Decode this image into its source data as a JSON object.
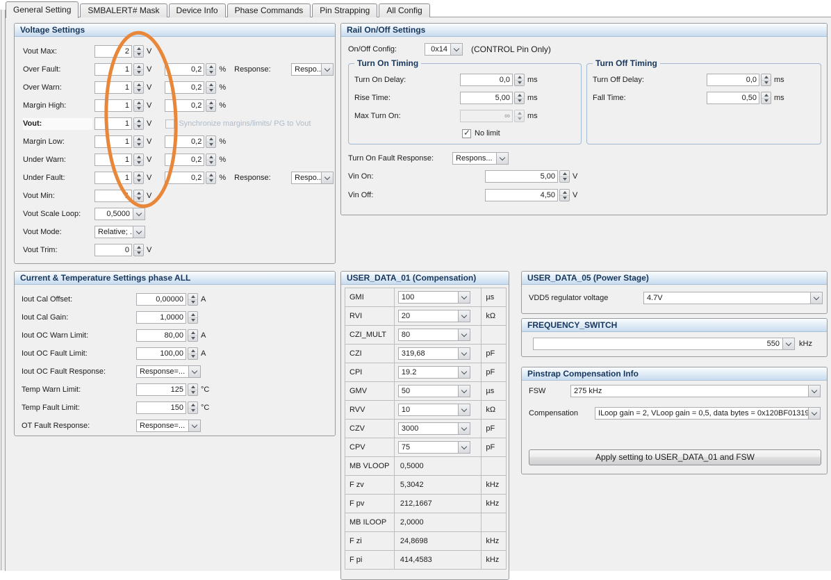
{
  "tabs": [
    {
      "label": "General Setting",
      "active": true
    },
    {
      "label": "SMBALERT# Mask",
      "active": false
    },
    {
      "label": "Device Info",
      "active": false
    },
    {
      "label": "Phase Commands",
      "active": false
    },
    {
      "label": "Pin Strapping",
      "active": false
    },
    {
      "label": "All Config",
      "active": false
    }
  ],
  "voltage": {
    "title": "Voltage Settings",
    "vout_max": {
      "label": "Vout Max:",
      "value": "2",
      "unit": "V"
    },
    "over_fault": {
      "label": "Over Fault:",
      "value": "1",
      "unit": "V",
      "pct": "0,2",
      "pct_unit": "%",
      "response_label": "Response:",
      "response": "Respo..."
    },
    "over_warn": {
      "label": "Over Warn:",
      "value": "1",
      "unit": "V",
      "pct": "0,2",
      "pct_unit": "%"
    },
    "margin_high": {
      "label": "Margin High:",
      "value": "1",
      "unit": "V",
      "pct": "0,2",
      "pct_unit": "%"
    },
    "vout": {
      "label": "Vout:",
      "value": "1",
      "unit": "V",
      "sync_label": "Synchronize margins/limits/ PG to Vout"
    },
    "margin_low": {
      "label": "Margin Low:",
      "value": "1",
      "unit": "V",
      "pct": "0,2",
      "pct_unit": "%"
    },
    "under_warn": {
      "label": "Under Warn:",
      "value": "1",
      "unit": "V",
      "pct": "0,2",
      "pct_unit": "%"
    },
    "under_fault": {
      "label": "Under Fault:",
      "value": "1",
      "unit": "V",
      "pct": "0,2",
      "pct_unit": "%",
      "response_label": "Response:",
      "response": "Respo..."
    },
    "vout_min": {
      "label": "Vout Min:",
      "value": "1",
      "unit": "V"
    },
    "vout_scale_loop": {
      "label": "Vout Scale Loop:",
      "value": "0,5000"
    },
    "vout_mode": {
      "label": "Vout Mode:",
      "value": "Relative; ..."
    },
    "vout_trim": {
      "label": "Vout Trim:",
      "value": "0",
      "unit": "V"
    }
  },
  "rail": {
    "title": "Rail On/Off Settings",
    "onoff_config": {
      "label": "On/Off Config:",
      "value": "0x14",
      "note": "(CONTROL Pin Only)"
    },
    "turn_on": {
      "title": "Turn On Timing",
      "delay": {
        "label": "Turn On Delay:",
        "value": "0,0",
        "unit": "ms"
      },
      "rise": {
        "label": "Rise Time:",
        "value": "5,00",
        "unit": "ms"
      },
      "max_on": {
        "label": "Max Turn On:",
        "value": "∞",
        "unit": "ms"
      },
      "no_limit_label": "No limit",
      "no_limit_checked": true
    },
    "turn_off": {
      "title": "Turn Off Timing",
      "delay": {
        "label": "Turn Off Delay:",
        "value": "0,0",
        "unit": "ms"
      },
      "fall": {
        "label": "Fall Time:",
        "value": "0,50",
        "unit": "ms"
      }
    },
    "fault_response": {
      "label": "Turn On Fault Response:",
      "value": "Respons..."
    },
    "vin_on": {
      "label": "Vin On:",
      "value": "5,00",
      "unit": "V"
    },
    "vin_off": {
      "label": "Vin Off:",
      "value": "4,50",
      "unit": "V"
    }
  },
  "current_temp": {
    "title": "Current & Temperature Settings phase ALL",
    "iout_cal_offset": {
      "label": "Iout Cal Offset:",
      "value": "0,00000",
      "unit": "A"
    },
    "iout_cal_gain": {
      "label": "Iout Cal Gain:",
      "value": "1,0000",
      "unit": ""
    },
    "iout_oc_warn": {
      "label": "Iout OC Warn Limit:",
      "value": "80,00",
      "unit": "A"
    },
    "iout_oc_fault": {
      "label": "Iout OC Fault Limit:",
      "value": "100,00",
      "unit": "A"
    },
    "iout_oc_fault_response": {
      "label": "Iout OC Fault Response:",
      "value": "Response=..."
    },
    "temp_warn": {
      "label": "Temp Warn Limit:",
      "value": "125",
      "unit": "°C"
    },
    "temp_fault": {
      "label": "Temp Fault Limit:",
      "value": "150",
      "unit": "°C"
    },
    "ot_fault_response": {
      "label": "OT Fault Response:",
      "value": "Response=..."
    }
  },
  "user_data_01": {
    "title": "USER_DATA_01 (Compensation)",
    "rows": [
      {
        "label": "GMI",
        "value": "100",
        "unit": "µs",
        "editable": true
      },
      {
        "label": "RVI",
        "value": "20",
        "unit": "kΩ",
        "editable": true
      },
      {
        "label": "CZI_MULT",
        "value": "80",
        "unit": "",
        "editable": true
      },
      {
        "label": "CZI",
        "value": "319,68",
        "unit": "pF",
        "editable": true
      },
      {
        "label": "CPI",
        "value": "19.2",
        "unit": "pF",
        "editable": true
      },
      {
        "label": "GMV",
        "value": "50",
        "unit": "µs",
        "editable": true
      },
      {
        "label": "RVV",
        "value": "10",
        "unit": "kΩ",
        "editable": true
      },
      {
        "label": "CZV",
        "value": "3000",
        "unit": "pF",
        "editable": true
      },
      {
        "label": "CPV",
        "value": "75",
        "unit": "pF",
        "editable": true
      },
      {
        "label": "MB VLOOP",
        "value": "0,5000",
        "unit": "",
        "editable": false
      },
      {
        "label": "F zv",
        "value": "5,3042",
        "unit": "kHz",
        "editable": false
      },
      {
        "label": "F pv",
        "value": "212,1667",
        "unit": "kHz",
        "editable": false
      },
      {
        "label": "MB ILOOP",
        "value": "2,0000",
        "unit": "",
        "editable": false
      },
      {
        "label": "F zi",
        "value": "24,8698",
        "unit": "kHz",
        "editable": false
      },
      {
        "label": "F pi",
        "value": "414,4583",
        "unit": "kHz",
        "editable": false
      }
    ]
  },
  "user_data_05": {
    "title": "USER_DATA_05 (Power Stage)",
    "vdd5": {
      "label": "VDD5 regulator voltage",
      "value": "4.7V"
    }
  },
  "frequency_switch": {
    "title": "FREQUENCY_SWITCH",
    "value": "550",
    "unit": "kHz"
  },
  "pinstrap": {
    "title": "Pinstrap Compensation Info",
    "fsw": {
      "label": "FSW",
      "value": "275 kHz"
    },
    "compensation": {
      "label": "Compensation",
      "value": "ILoop gain = 2, VLoop gain = 0,5, data bytes = 0x120BF01319"
    },
    "apply_button": "Apply setting to USER_DATA_01 and FSW"
  },
  "annotation": {
    "type": "ellipse",
    "color": "#E8873A"
  },
  "colors": {
    "header_text": "#17365D",
    "panel_bg": "#F0F0F0",
    "accent_orange": "#E8873A"
  }
}
